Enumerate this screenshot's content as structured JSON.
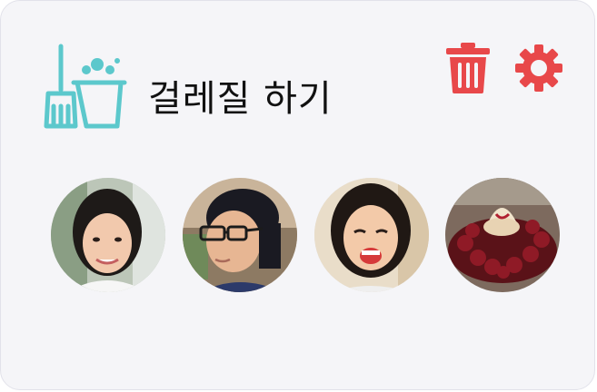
{
  "task": {
    "title": "걸레질 하기",
    "icon": "broom-bucket-icon",
    "icon_color": "#5cc8cc"
  },
  "actions": {
    "delete_icon": "trash-icon",
    "settings_icon": "gear-icon",
    "accent_color": "#e8484a"
  },
  "members": [
    {
      "name": "avatar-woman-smiling"
    },
    {
      "name": "avatar-man-glasses"
    },
    {
      "name": "avatar-woman-laughing"
    },
    {
      "name": "avatar-cherry-dessert"
    }
  ]
}
